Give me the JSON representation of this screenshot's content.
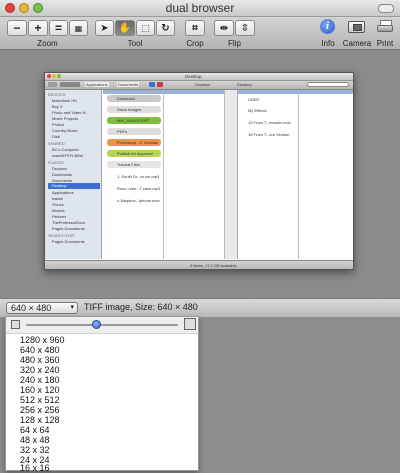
{
  "window": {
    "title": "dual browser"
  },
  "toolbar": {
    "zoom_label": "Zoom",
    "tool_label": "Tool",
    "crop_label": "Crop",
    "flip_label": "Flip",
    "info_label": "Info",
    "camera_label": "Camera",
    "print_label": "Print"
  },
  "preview": {
    "window_title": "Desktop",
    "path_bar": [
      "Applications",
      "Documents",
      "Dropbox",
      "Desktop"
    ],
    "sidebar_sections": [
      {
        "title": "DEVICES",
        "items": [
          "Macintosh HD",
          "Boy 3",
          "Photo and Video H...",
          "Movie Projects",
          "Photos",
          "Country Music",
          "Disk"
        ]
      },
      {
        "title": "SHARED",
        "items": [
          "BC's Computer",
          "macbKFSYLB#W"
        ]
      },
      {
        "title": "PLACES",
        "items": [
          "Dropbox",
          "Downloads",
          "Documents",
          "Desktop",
          "Applications",
          "bakari",
          "iTunes",
          "Movies",
          "Pictures",
          "TheProfessorDocs",
          "Pages Documents"
        ]
      },
      {
        "title": "SEARCH FOR",
        "items": [
          "Pages Documents"
        ]
      }
    ],
    "pane1_items": [
      "Download",
      "Stock Images",
      "MM_JAVASCRIPT",
      "PDFs",
      "Photoshop - 2 Tutorials",
      "Publish for Approval",
      "Tutorial Files",
      "1. South Dr...br cut.mp3",
      "Runs Leen...T.case.mp3",
      "c-3dsphoe...iphone.mov"
    ],
    "pane2_items": [
      "USER",
      "My Effects",
      "13 From T...ersonic.m4v",
      "16 From T...our Version"
    ],
    "status": "9 items, 17.2 GB available"
  },
  "status_bar": {
    "size_selection": "640 × 480",
    "info": "TIFF image, Size: 640 × 480"
  },
  "size_menu": {
    "items": [
      "1280 x 960",
      "640 x 480",
      "480 x 360",
      "320 x 240",
      "240 x 180",
      "160 x 120",
      "512 x 512",
      "256 x 256",
      "128 x 128",
      "64 x 64",
      "48 x 48",
      "32 x 32",
      "24 x 24",
      "16 x 16"
    ],
    "slider_fraction": 0.46
  },
  "colors": {
    "accent": "#3b6fd4",
    "folder_green": "#7fbf3f",
    "folder_orange": "#e8944a"
  }
}
